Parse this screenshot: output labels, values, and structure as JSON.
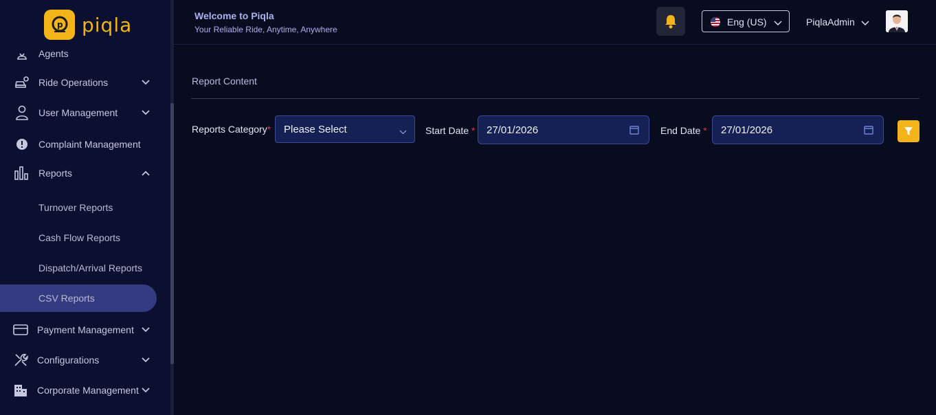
{
  "brand": {
    "logo_text": "piqla",
    "accent": "#f2b418"
  },
  "sidebar": {
    "items": [
      {
        "label": "Agents",
        "icon": "agent-icon",
        "chevron": false
      },
      {
        "label": "Ride Operations",
        "icon": "car-gear-icon",
        "chevron": "down"
      },
      {
        "label": "User Management",
        "icon": "user-icon",
        "chevron": "down"
      },
      {
        "label": "Complaint Management",
        "icon": "alert-circle-icon",
        "chevron": false
      },
      {
        "label": "Reports",
        "icon": "bar-chart-icon",
        "chevron": "up"
      },
      {
        "label": "Payment Management",
        "icon": "card-icon",
        "chevron": "down"
      },
      {
        "label": "Configurations",
        "icon": "tools-icon",
        "chevron": "down"
      },
      {
        "label": "Corporate Management",
        "icon": "building-icon",
        "chevron": "down"
      }
    ],
    "report_sub_items": [
      {
        "label": "Turnover Reports"
      },
      {
        "label": "Cash Flow Reports"
      },
      {
        "label": "Dispatch/Arrival Reports"
      },
      {
        "label": "CSV Reports",
        "active": true
      }
    ],
    "active_color": "#353b80"
  },
  "header": {
    "welcome": "Welcome to Piqla",
    "tagline": "Your Reliable Ride, Anytime, Anywhere",
    "language": "Eng (US)",
    "user_name": "PiqlaAdmin"
  },
  "main": {
    "section_title": "Report Content",
    "filters": {
      "category_label": "Reports Category",
      "category_value": "Please Select",
      "start_label": "Start Date",
      "start_value": "27/01/2026",
      "end_label": "End Date",
      "end_value": "27/01/2026",
      "required_mark": "*"
    }
  }
}
